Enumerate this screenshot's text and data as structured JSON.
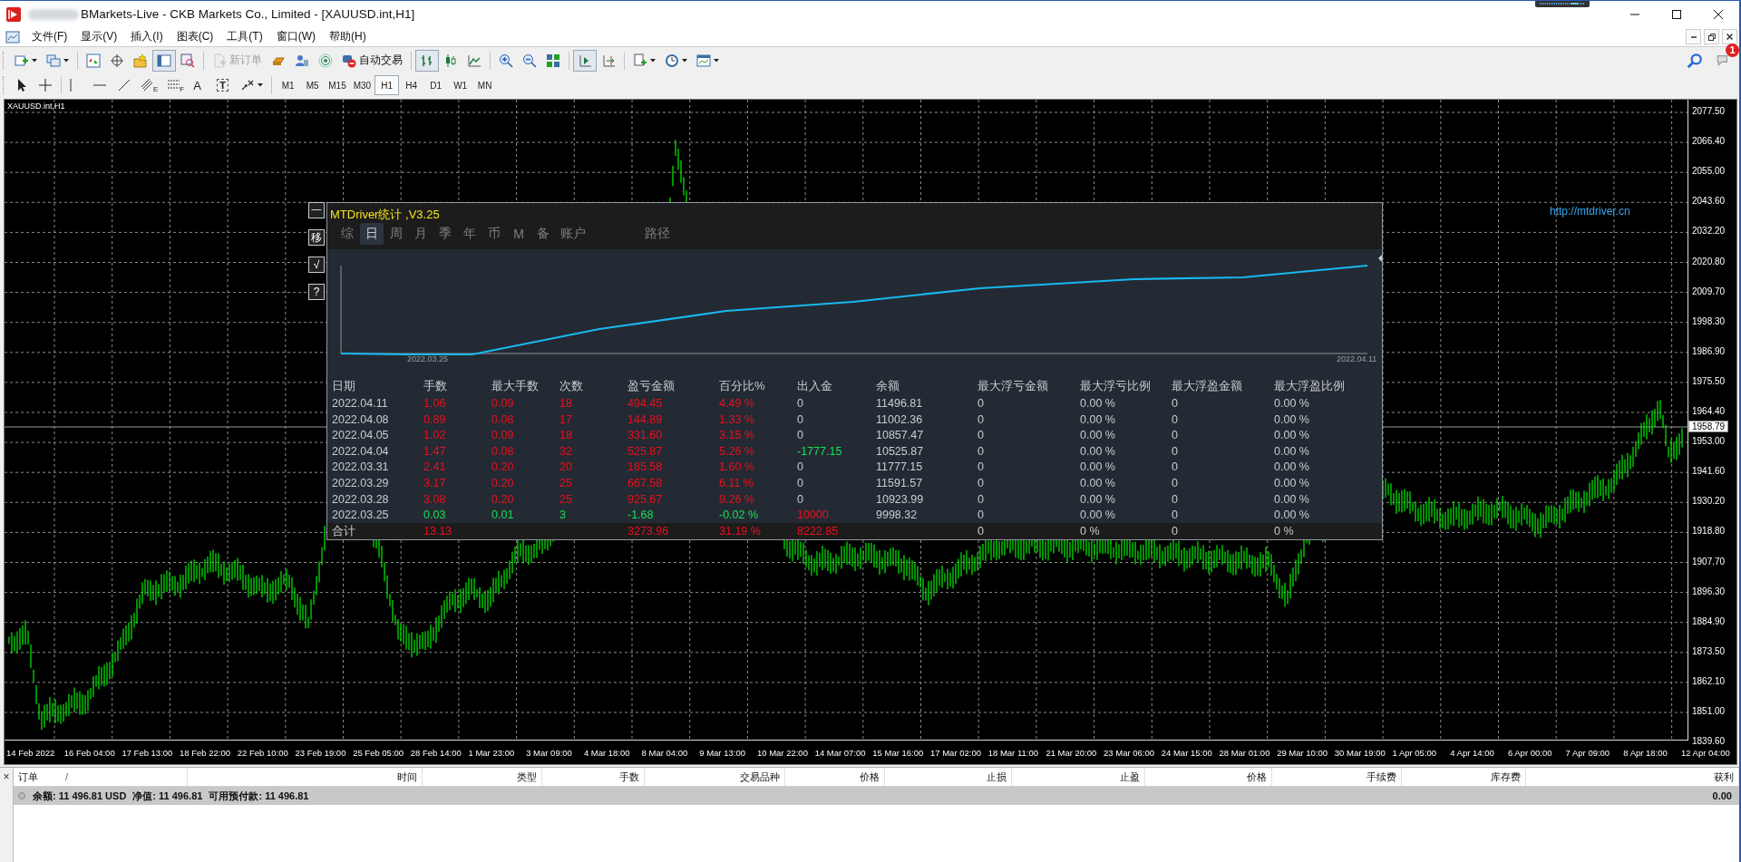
{
  "window": {
    "title": "BMarkets-Live - CKB Markets Co., Limited - [XAUUSD.int,H1]"
  },
  "menu": [
    "文件(F)",
    "显示(V)",
    "插入(I)",
    "图表(C)",
    "工具(T)",
    "窗口(W)",
    "帮助(H)"
  ],
  "toolbar_main": [
    {
      "kind": "new-chart",
      "caret": true,
      "pressed": false,
      "disabled": false
    },
    {
      "kind": "profiles",
      "caret": true,
      "pressed": false,
      "disabled": false
    },
    {
      "kind": "separator"
    },
    {
      "kind": "market-watch",
      "caret": false,
      "pressed": false,
      "disabled": false
    },
    {
      "kind": "navigator",
      "caret": false,
      "pressed": false,
      "disabled": false
    },
    {
      "kind": "favorites",
      "caret": false,
      "pressed": false,
      "disabled": false
    },
    {
      "kind": "terminal",
      "caret": false,
      "pressed": true,
      "disabled": false
    },
    {
      "kind": "tester",
      "caret": false,
      "pressed": false,
      "disabled": false
    },
    {
      "kind": "separator"
    },
    {
      "kind": "new-order",
      "label": "新订单",
      "caret": false,
      "pressed": false,
      "disabled": true
    },
    {
      "kind": "editor",
      "caret": false,
      "pressed": false,
      "disabled": false
    },
    {
      "kind": "community",
      "caret": false,
      "pressed": false,
      "disabled": false
    },
    {
      "kind": "signals",
      "caret": false,
      "pressed": false,
      "disabled": false
    },
    {
      "kind": "auto-trading",
      "label": "自动交易",
      "caret": false,
      "pressed": false,
      "disabled": false
    },
    {
      "kind": "separator"
    },
    {
      "kind": "bar-chart",
      "caret": false,
      "pressed": true,
      "disabled": false
    },
    {
      "kind": "candles",
      "caret": false,
      "pressed": false,
      "disabled": false
    },
    {
      "kind": "line-chart",
      "caret": false,
      "pressed": false,
      "disabled": false
    },
    {
      "kind": "separator"
    },
    {
      "kind": "zoom-in",
      "caret": false,
      "pressed": false,
      "disabled": false
    },
    {
      "kind": "zoom-out",
      "caret": false,
      "pressed": false,
      "disabled": false
    },
    {
      "kind": "tile",
      "caret": false,
      "pressed": false,
      "disabled": false
    },
    {
      "kind": "separator"
    },
    {
      "kind": "autoscroll",
      "caret": false,
      "pressed": true,
      "disabled": false
    },
    {
      "kind": "chart-shift",
      "caret": false,
      "pressed": false,
      "disabled": false
    },
    {
      "kind": "separator"
    },
    {
      "kind": "indicators",
      "caret": true,
      "pressed": false,
      "disabled": false
    },
    {
      "kind": "periods",
      "caret": true,
      "pressed": false,
      "disabled": false
    },
    {
      "kind": "templates",
      "caret": true,
      "pressed": false,
      "disabled": false
    }
  ],
  "toolbar_draw": [
    {
      "kind": "cursor",
      "caret": false,
      "pressed": false,
      "disabled": false
    },
    {
      "kind": "crosshair",
      "caret": false,
      "pressed": false,
      "disabled": false
    },
    {
      "kind": "separator"
    },
    {
      "kind": "vertical-line",
      "caret": false,
      "pressed": false,
      "disabled": false
    },
    {
      "kind": "horizontal-line",
      "caret": false,
      "pressed": false,
      "disabled": false
    },
    {
      "kind": "trend-line",
      "caret": false,
      "pressed": false,
      "disabled": false
    },
    {
      "kind": "channel",
      "label": "E",
      "caret": false,
      "pressed": false,
      "disabled": false
    },
    {
      "kind": "fibonacci",
      "label": "F",
      "caret": false,
      "pressed": false,
      "disabled": false
    },
    {
      "kind": "text",
      "label": "A",
      "caret": false,
      "pressed": false,
      "disabled": false
    },
    {
      "kind": "text-label",
      "label": "T",
      "caret": false,
      "pressed": false,
      "disabled": false
    },
    {
      "kind": "arrows",
      "caret": true,
      "pressed": false,
      "disabled": false
    }
  ],
  "timeframes": [
    {
      "label": "M1",
      "selected": false
    },
    {
      "label": "M5",
      "selected": false
    },
    {
      "label": "M15",
      "selected": false
    },
    {
      "label": "M30",
      "selected": false
    },
    {
      "label": "H1",
      "selected": true
    },
    {
      "label": "H4",
      "selected": false
    },
    {
      "label": "D1",
      "selected": false
    },
    {
      "label": "W1",
      "selected": false
    },
    {
      "label": "MN",
      "selected": false
    }
  ],
  "notifications": {
    "badge": "1"
  },
  "chart": {
    "symbol": "XAUUSD.int,H1",
    "current_price": "1958.79",
    "price_ticks": [
      "2077.50",
      "2066.40",
      "2055.00",
      "2043.60",
      "2032.20",
      "2020.80",
      "2009.70",
      "1998.30",
      "1986.90",
      "1975.50",
      "1964.40",
      "1953.00",
      "1941.60",
      "1930.20",
      "1918.80",
      "1907.70",
      "1896.30",
      "1884.90",
      "1873.50",
      "1862.10",
      "1851.00",
      "1839.60"
    ],
    "time_labels": [
      "14 Feb 2022",
      "16 Feb 04:00",
      "17 Feb 13:00",
      "18 Feb 22:00",
      "22 Feb 10:00",
      "23 Feb 19:00",
      "25 Feb 05:00",
      "28 Feb 14:00",
      "1 Mar 23:00",
      "3 Mar 09:00",
      "4 Mar 18:00",
      "8 Mar 04:00",
      "9 Mar 13:00",
      "10 Mar 22:00",
      "14 Mar 07:00",
      "15 Mar 16:00",
      "17 Mar 02:00",
      "18 Mar 11:00",
      "21 Mar 20:00",
      "23 Mar 06:00",
      "24 Mar 15:00",
      "28 Mar 01:00",
      "29 Mar 10:00",
      "30 Mar 19:00",
      "1 Apr 05:00",
      "4 Apr 14:00",
      "6 Apr 00:00",
      "7 Apr 09:00",
      "8 Apr 18:00",
      "12 Apr 04:00"
    ]
  },
  "stats": {
    "title": "MTDriver统计 ,V3.25",
    "side_buttons": [
      "一",
      "移",
      "√",
      "?"
    ],
    "link": "http://mtdriver.cn",
    "tabs": [
      {
        "label": "综",
        "selected": false
      },
      {
        "label": "日",
        "selected": true
      },
      {
        "label": "周",
        "selected": false
      },
      {
        "label": "月",
        "selected": false
      },
      {
        "label": "季",
        "selected": false
      },
      {
        "label": "年",
        "selected": false
      },
      {
        "label": "币",
        "selected": false
      },
      {
        "label": "M",
        "selected": false
      },
      {
        "label": "备",
        "selected": false
      },
      {
        "label": "账户",
        "selected": false
      }
    ],
    "path_button": "路径",
    "curve_start": "2022.03.25",
    "curve_end": "2022.04.11",
    "columns": [
      "日期",
      "手数",
      "最大手数",
      "次数",
      "盈亏金额",
      "百分比%",
      "出入金",
      "余额",
      "最大浮亏金额",
      "最大浮亏比例",
      "最大浮盈金额",
      "最大浮盈比例"
    ],
    "rows": [
      {
        "cells": [
          "2022.04.11",
          "1.06",
          "0.09",
          "18",
          "494.45",
          "4.49 %",
          "0",
          "11496.81",
          "0",
          "0.00 %",
          "0",
          "0.00 %"
        ],
        "color": "#e8101c",
        "flow": {
          "color": "#c8ccd2"
        }
      },
      {
        "cells": [
          "2022.04.08",
          "0.89",
          "0.08",
          "17",
          "144.89",
          "1.33 %",
          "0",
          "11002.36",
          "0",
          "0.00 %",
          "0",
          "0.00 %"
        ],
        "color": "#e8101c",
        "flow": {
          "color": "#c8ccd2"
        }
      },
      {
        "cells": [
          "2022.04.05",
          "1.02",
          "0.09",
          "18",
          "331.60",
          "3.15 %",
          "0",
          "10857.47",
          "0",
          "0.00 %",
          "0",
          "0.00 %"
        ],
        "color": "#e8101c",
        "flow": {
          "color": "#c8ccd2"
        }
      },
      {
        "cells": [
          "2022.04.04",
          "1.47",
          "0.08",
          "32",
          "525.87",
          "5.26 %",
          "-1777.15",
          "10525.87",
          "0",
          "0.00 %",
          "0",
          "0.00 %"
        ],
        "color": "#e8101c",
        "flow": {
          "color": "#19e05a"
        }
      },
      {
        "cells": [
          "2022.03.31",
          "2.41",
          "0.20",
          "20",
          "185.58",
          "1.60 %",
          "0",
          "11777.15",
          "0",
          "0.00 %",
          "0",
          "0.00 %"
        ],
        "color": "#e8101c",
        "flow": {
          "color": "#c8ccd2"
        }
      },
      {
        "cells": [
          "2022.03.29",
          "3.17",
          "0.20",
          "25",
          "667.58",
          "6.11 %",
          "0",
          "11591.57",
          "0",
          "0.00 %",
          "0",
          "0.00 %"
        ],
        "color": "#e8101c",
        "flow": {
          "color": "#c8ccd2"
        }
      },
      {
        "cells": [
          "2022.03.28",
          "3.08",
          "0.20",
          "25",
          "925.67",
          "9.26 %",
          "0",
          "10923.99",
          "0",
          "0.00 %",
          "0",
          "0.00 %"
        ],
        "color": "#e8101c",
        "flow": {
          "color": "#c8ccd2"
        }
      },
      {
        "cells": [
          "2022.03.25",
          "0.03",
          "0.01",
          "3",
          "-1.68",
          "-0.02 %",
          "10000",
          "9998.32",
          "0",
          "0.00 %",
          "0",
          "0.00 %"
        ],
        "color": "#19e05a",
        "flow": {
          "color": "#e8101c"
        }
      }
    ],
    "total": {
      "label": "合计",
      "lots": "13.13",
      "pnl": "3273.96",
      "percent": "31.19 %",
      "flow": "8222.85",
      "max_float_loss": "0",
      "max_float_loss_pct": "0 %",
      "max_float_profit": "0",
      "max_float_profit_pct": "0 %",
      "color": "#e8101c"
    }
  },
  "terminal": {
    "close": "×",
    "sort_mark": "/",
    "columns": [
      "订单",
      "时间",
      "类型",
      "手数",
      "交易品种",
      "价格",
      "止损",
      "止盈",
      "价格",
      "手续费",
      "库存费",
      "获利"
    ],
    "balance": [
      "余额: 11 496.81 USD",
      "净值: 11 496.81",
      "可用预付款: 11 496.81"
    ],
    "profit": "0.00"
  }
}
